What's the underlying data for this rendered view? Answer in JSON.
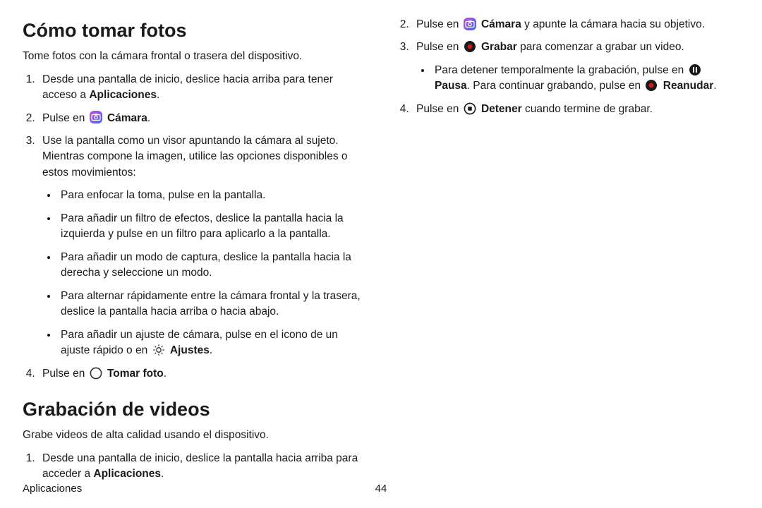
{
  "section1": {
    "title": "Cómo tomar fotos",
    "intro": "Tome fotos con la cámara frontal o trasera del dispositivo.",
    "step1_a": "Desde una pantalla de inicio, deslice hacia arriba para tener acceso a ",
    "step1_b": "Aplicaciones",
    "step1_c": ".",
    "step2_a": "Pulse en ",
    "step2_b": "Cámara",
    "step2_c": ".",
    "step3": "Use la pantalla como un visor apuntando la cámara al sujeto. Mientras compone la imagen, utilice las opciones disponibles o estos movimientos:",
    "b1": "Para enfocar la toma, pulse en la pantalla.",
    "b2": "Para añadir un filtro de efectos, deslice la pantalla hacia la izquierda y pulse en un filtro para aplicarlo a la pantalla.",
    "b3": "Para añadir un modo de captura, deslice la pantalla hacia la derecha y seleccione un modo.",
    "b4": "Para alternar rápidamente entre la cámara frontal y la trasera, deslice la pantalla hacia arriba o hacia abajo.",
    "b5_a": "Para añadir un ajuste de cámara, pulse en el icono de un ajuste rápido o en ",
    "b5_b": "Ajustes",
    "b5_c": ".",
    "step4_a": "Pulse en ",
    "step4_b": "Tomar foto",
    "step4_c": "."
  },
  "section2": {
    "title": "Grabación de videos",
    "intro": "Grabe videos de alta calidad usando el dispositivo.",
    "s1_a": "Desde una pantalla de inicio, deslice la pantalla hacia arriba para acceder a ",
    "s1_b": "Aplicaciones",
    "s1_c": ".",
    "s2_a": "Pulse en ",
    "s2_b": "Cámara",
    "s2_c": " y apunte la cámara hacia su objetivo.",
    "s3_a": "Pulse en ",
    "s3_b": "Grabar",
    "s3_c": " para comenzar a grabar un video.",
    "sb1_a": "Para detener temporalmente la grabación, pulse en ",
    "sb1_b": "Pausa",
    "sb1_c": ". Para continuar grabando, pulse en ",
    "sb1_d": "Reanudar",
    "sb1_e": ".",
    "s4_a": "Pulse en ",
    "s4_b": "Detener",
    "s4_c": " cuando termine de grabar."
  },
  "footer": {
    "label": "Aplicaciones",
    "page": "44"
  }
}
